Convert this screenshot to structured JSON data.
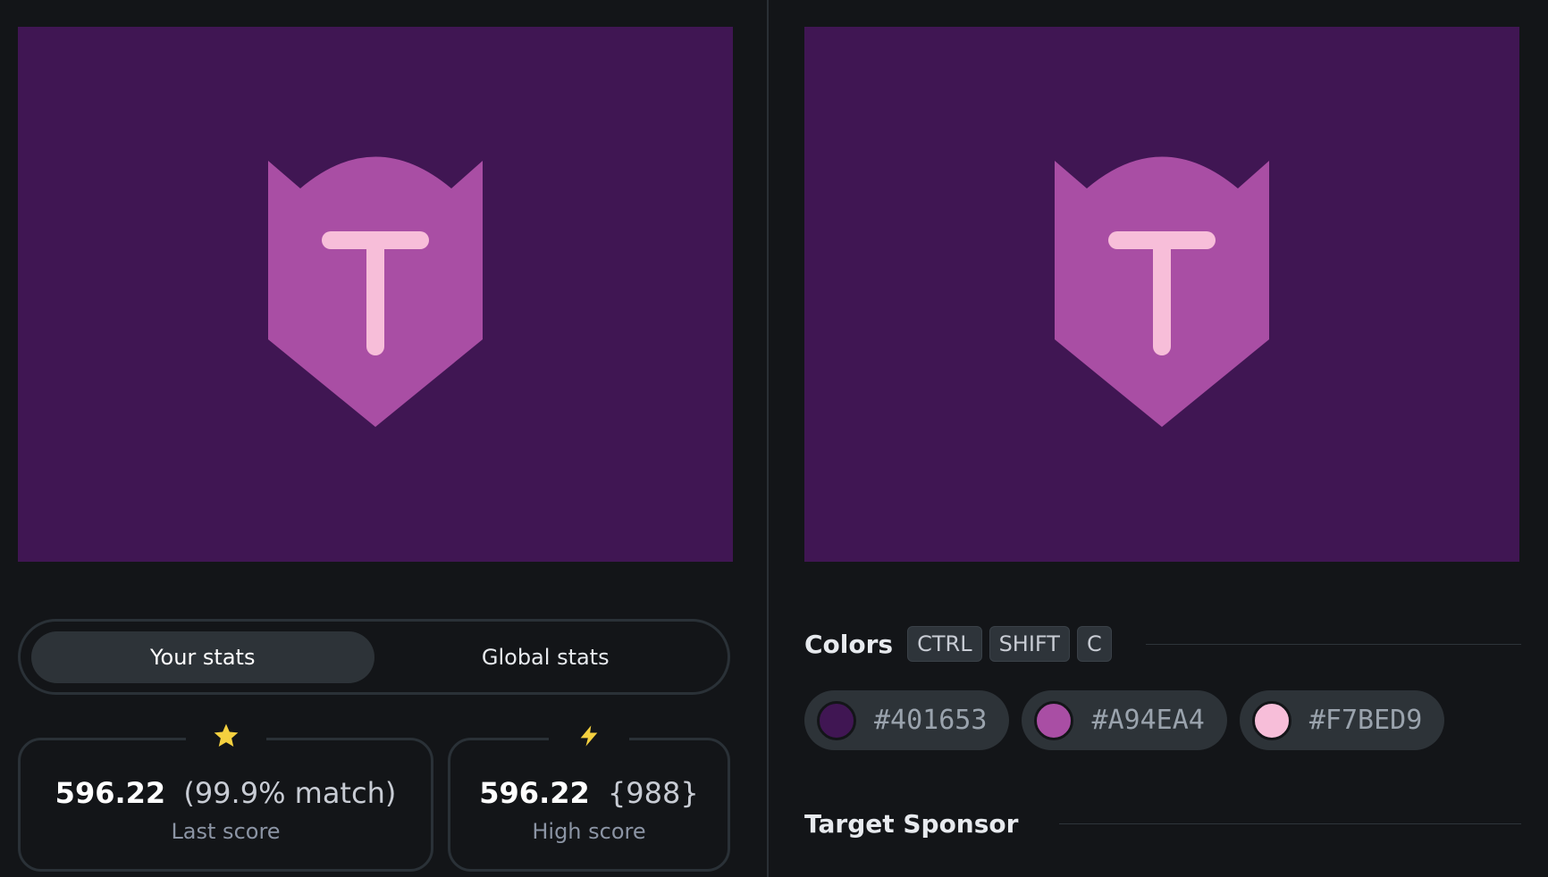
{
  "colors": {
    "background": "#401653",
    "shape": "#A94EA4",
    "letter": "#F7BED9"
  },
  "tabs": {
    "your_stats": "Your stats",
    "global_stats": "Global stats"
  },
  "stats": {
    "last": {
      "icon": "star-icon",
      "value": "596.22",
      "extra": "(99.9% match)",
      "label": "Last score"
    },
    "high": {
      "icon": "lightning-icon",
      "value": "596.22",
      "extra": "{988}",
      "label": "High score"
    }
  },
  "colors_section": {
    "title": "Colors",
    "shortcut": [
      "CTRL",
      "SHIFT",
      "C"
    ],
    "swatches": [
      {
        "hex": "#401653",
        "color": "#401653"
      },
      {
        "hex": "#A94EA4",
        "color": "#A94EA4"
      },
      {
        "hex": "#F7BED9",
        "color": "#F7BED9"
      }
    ]
  },
  "sponsor_section": {
    "title": "Target Sponsor"
  }
}
